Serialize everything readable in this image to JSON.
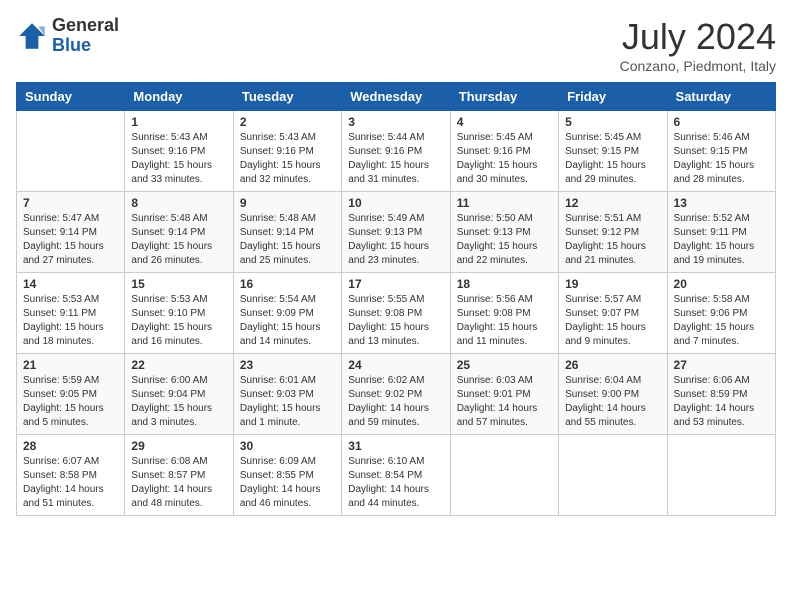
{
  "header": {
    "logo_line1": "General",
    "logo_line2": "Blue",
    "month": "July 2024",
    "location": "Conzano, Piedmont, Italy"
  },
  "days_of_week": [
    "Sunday",
    "Monday",
    "Tuesday",
    "Wednesday",
    "Thursday",
    "Friday",
    "Saturday"
  ],
  "weeks": [
    [
      {
        "day": "",
        "info": ""
      },
      {
        "day": "1",
        "info": "Sunrise: 5:43 AM\nSunset: 9:16 PM\nDaylight: 15 hours\nand 33 minutes."
      },
      {
        "day": "2",
        "info": "Sunrise: 5:43 AM\nSunset: 9:16 PM\nDaylight: 15 hours\nand 32 minutes."
      },
      {
        "day": "3",
        "info": "Sunrise: 5:44 AM\nSunset: 9:16 PM\nDaylight: 15 hours\nand 31 minutes."
      },
      {
        "day": "4",
        "info": "Sunrise: 5:45 AM\nSunset: 9:16 PM\nDaylight: 15 hours\nand 30 minutes."
      },
      {
        "day": "5",
        "info": "Sunrise: 5:45 AM\nSunset: 9:15 PM\nDaylight: 15 hours\nand 29 minutes."
      },
      {
        "day": "6",
        "info": "Sunrise: 5:46 AM\nSunset: 9:15 PM\nDaylight: 15 hours\nand 28 minutes."
      }
    ],
    [
      {
        "day": "7",
        "info": "Sunrise: 5:47 AM\nSunset: 9:14 PM\nDaylight: 15 hours\nand 27 minutes."
      },
      {
        "day": "8",
        "info": "Sunrise: 5:48 AM\nSunset: 9:14 PM\nDaylight: 15 hours\nand 26 minutes."
      },
      {
        "day": "9",
        "info": "Sunrise: 5:48 AM\nSunset: 9:14 PM\nDaylight: 15 hours\nand 25 minutes."
      },
      {
        "day": "10",
        "info": "Sunrise: 5:49 AM\nSunset: 9:13 PM\nDaylight: 15 hours\nand 23 minutes."
      },
      {
        "day": "11",
        "info": "Sunrise: 5:50 AM\nSunset: 9:13 PM\nDaylight: 15 hours\nand 22 minutes."
      },
      {
        "day": "12",
        "info": "Sunrise: 5:51 AM\nSunset: 9:12 PM\nDaylight: 15 hours\nand 21 minutes."
      },
      {
        "day": "13",
        "info": "Sunrise: 5:52 AM\nSunset: 9:11 PM\nDaylight: 15 hours\nand 19 minutes."
      }
    ],
    [
      {
        "day": "14",
        "info": "Sunrise: 5:53 AM\nSunset: 9:11 PM\nDaylight: 15 hours\nand 18 minutes."
      },
      {
        "day": "15",
        "info": "Sunrise: 5:53 AM\nSunset: 9:10 PM\nDaylight: 15 hours\nand 16 minutes."
      },
      {
        "day": "16",
        "info": "Sunrise: 5:54 AM\nSunset: 9:09 PM\nDaylight: 15 hours\nand 14 minutes."
      },
      {
        "day": "17",
        "info": "Sunrise: 5:55 AM\nSunset: 9:08 PM\nDaylight: 15 hours\nand 13 minutes."
      },
      {
        "day": "18",
        "info": "Sunrise: 5:56 AM\nSunset: 9:08 PM\nDaylight: 15 hours\nand 11 minutes."
      },
      {
        "day": "19",
        "info": "Sunrise: 5:57 AM\nSunset: 9:07 PM\nDaylight: 15 hours\nand 9 minutes."
      },
      {
        "day": "20",
        "info": "Sunrise: 5:58 AM\nSunset: 9:06 PM\nDaylight: 15 hours\nand 7 minutes."
      }
    ],
    [
      {
        "day": "21",
        "info": "Sunrise: 5:59 AM\nSunset: 9:05 PM\nDaylight: 15 hours\nand 5 minutes."
      },
      {
        "day": "22",
        "info": "Sunrise: 6:00 AM\nSunset: 9:04 PM\nDaylight: 15 hours\nand 3 minutes."
      },
      {
        "day": "23",
        "info": "Sunrise: 6:01 AM\nSunset: 9:03 PM\nDaylight: 15 hours\nand 1 minute."
      },
      {
        "day": "24",
        "info": "Sunrise: 6:02 AM\nSunset: 9:02 PM\nDaylight: 14 hours\nand 59 minutes."
      },
      {
        "day": "25",
        "info": "Sunrise: 6:03 AM\nSunset: 9:01 PM\nDaylight: 14 hours\nand 57 minutes."
      },
      {
        "day": "26",
        "info": "Sunrise: 6:04 AM\nSunset: 9:00 PM\nDaylight: 14 hours\nand 55 minutes."
      },
      {
        "day": "27",
        "info": "Sunrise: 6:06 AM\nSunset: 8:59 PM\nDaylight: 14 hours\nand 53 minutes."
      }
    ],
    [
      {
        "day": "28",
        "info": "Sunrise: 6:07 AM\nSunset: 8:58 PM\nDaylight: 14 hours\nand 51 minutes."
      },
      {
        "day": "29",
        "info": "Sunrise: 6:08 AM\nSunset: 8:57 PM\nDaylight: 14 hours\nand 48 minutes."
      },
      {
        "day": "30",
        "info": "Sunrise: 6:09 AM\nSunset: 8:55 PM\nDaylight: 14 hours\nand 46 minutes."
      },
      {
        "day": "31",
        "info": "Sunrise: 6:10 AM\nSunset: 8:54 PM\nDaylight: 14 hours\nand 44 minutes."
      },
      {
        "day": "",
        "info": ""
      },
      {
        "day": "",
        "info": ""
      },
      {
        "day": "",
        "info": ""
      }
    ]
  ]
}
